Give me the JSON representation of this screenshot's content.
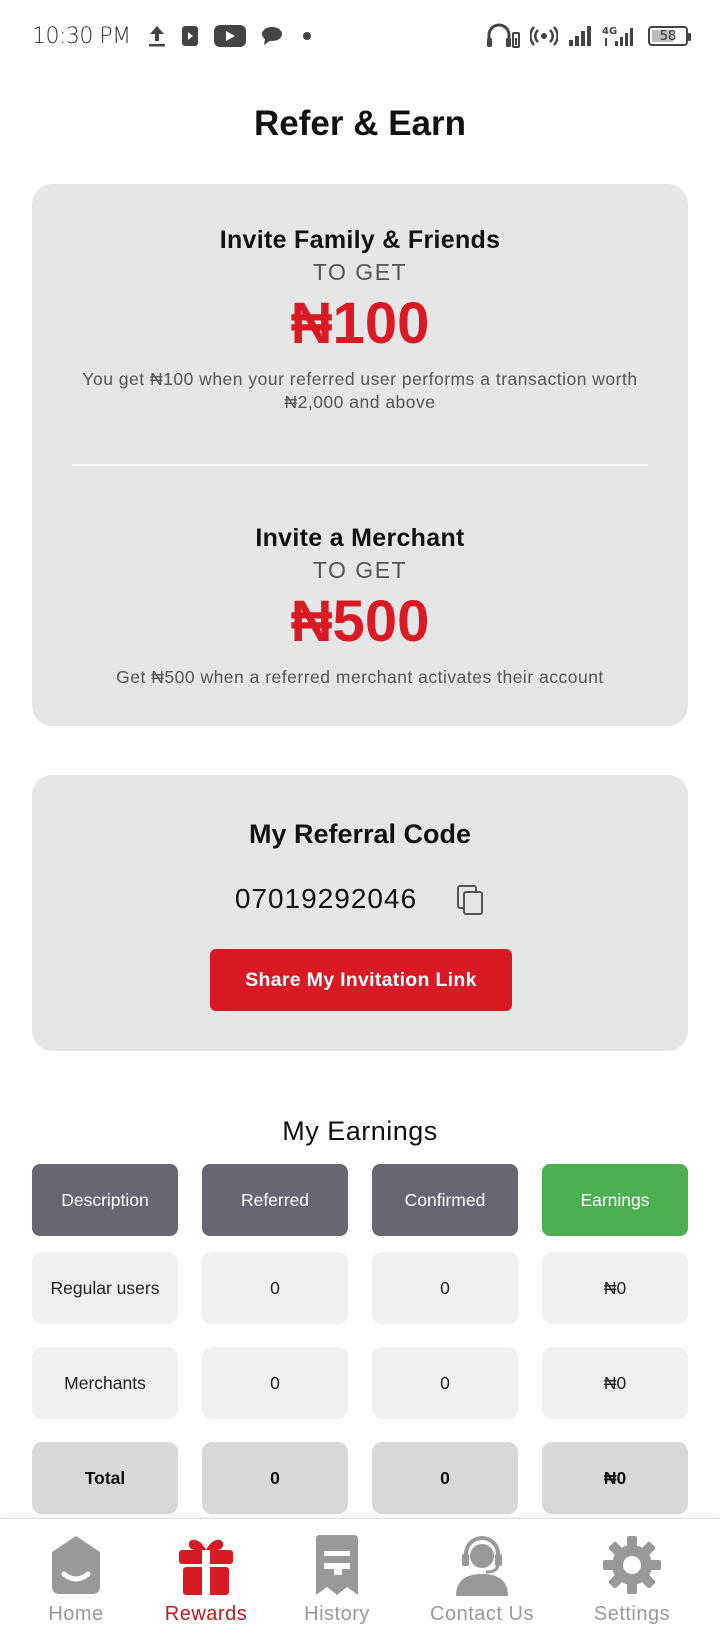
{
  "status_bar": {
    "time": "10:30 PM",
    "battery": "58",
    "network": "4G",
    "left_icons": [
      "upload-icon",
      "media-icon",
      "youtube-icon",
      "chat-icon",
      "dot-icon"
    ],
    "right_icons": [
      "headset-battery-icon",
      "hotspot-icon",
      "signal-icon",
      "signal-4g-icon",
      "battery-icon"
    ]
  },
  "page": {
    "title": "Refer & Earn"
  },
  "promo": {
    "family": {
      "heading": "Invite Family & Friends",
      "to_get": "TO GET",
      "amount": "₦100",
      "description": "You get ₦100 when your referred user performs a transaction worth ₦2,000 and above"
    },
    "merchant": {
      "heading": "Invite a Merchant",
      "to_get": "TO GET",
      "amount": "₦500",
      "description": "Get ₦500 when a referred merchant activates their account"
    }
  },
  "referral": {
    "title": "My Referral Code",
    "code": "07019292046",
    "share_label": "Share My Invitation Link"
  },
  "earnings": {
    "title": "My Earnings",
    "headers": [
      "Description",
      "Referred",
      "Confirmed",
      "Earnings"
    ],
    "rows": [
      [
        "Regular users",
        "0",
        "0",
        "₦0"
      ],
      [
        "Merchants",
        "0",
        "0",
        "₦0"
      ]
    ],
    "total": [
      "Total",
      "0",
      "0",
      "₦0"
    ]
  },
  "nav": {
    "items": [
      {
        "label": "Home",
        "icon": "home-icon"
      },
      {
        "label": "Rewards",
        "icon": "gift-icon"
      },
      {
        "label": "History",
        "icon": "receipt-icon"
      },
      {
        "label": "Contact Us",
        "icon": "support-agent-icon"
      },
      {
        "label": "Settings",
        "icon": "gear-icon"
      }
    ],
    "active": "Rewards"
  },
  "colors": {
    "accent_red": "#d91a24",
    "header_gray": "#676672",
    "earnings_green": "#4cb052",
    "card_bg": "#e6e6e6",
    "nav_inactive": "#999999"
  }
}
